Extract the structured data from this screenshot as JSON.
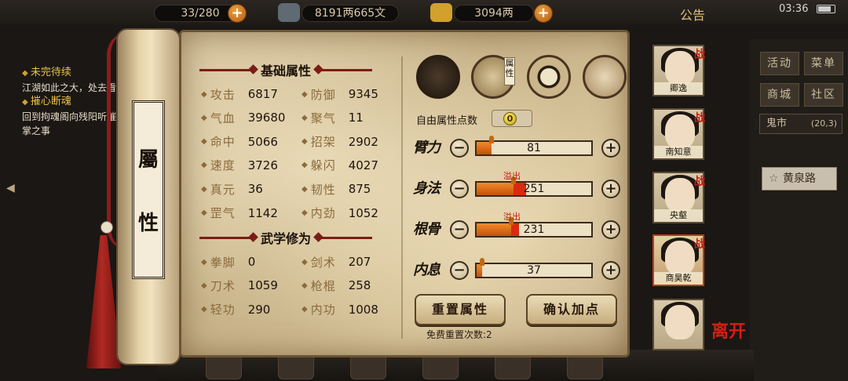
{
  "top_bar": {
    "stamina": "33/280",
    "money": "8191两665文",
    "gold": "3094两",
    "announcement": "公告",
    "time": "03:36"
  },
  "quests": [
    {
      "title": "未完待续",
      "desc": "江湖如此之大，处去看看"
    },
    {
      "title": "摧心断魂",
      "desc": "回到拘魂阁向残阳听摧心掌之事"
    }
  ],
  "right_menu": {
    "buttons": [
      "活动",
      "菜单",
      "商城",
      "社区"
    ],
    "location": "鬼市",
    "coords": "(20,3)",
    "road": "黄泉路"
  },
  "scroll": {
    "title_chars": [
      "屬",
      "性"
    ]
  },
  "basic": {
    "title": "基础属性",
    "stats": [
      {
        "label": "攻击",
        "value": "6817"
      },
      {
        "label": "防御",
        "value": "9345"
      },
      {
        "label": "气血",
        "value": "39680"
      },
      {
        "label": "聚气",
        "value": "11"
      },
      {
        "label": "命中",
        "value": "5066"
      },
      {
        "label": "招架",
        "value": "2902"
      },
      {
        "label": "速度",
        "value": "3726"
      },
      {
        "label": "躲闪",
        "value": "4027"
      },
      {
        "label": "真元",
        "value": "36"
      },
      {
        "label": "韧性",
        "value": "875"
      },
      {
        "label": "罡气",
        "value": "1142"
      },
      {
        "label": "内劲",
        "value": "1052"
      }
    ]
  },
  "martial": {
    "title": "武学修为",
    "stats": [
      {
        "label": "拳脚",
        "value": "0"
      },
      {
        "label": "剑术",
        "value": "207"
      },
      {
        "label": "刀术",
        "value": "1059"
      },
      {
        "label": "枪棍",
        "value": "258"
      },
      {
        "label": "轻功",
        "value": "290"
      },
      {
        "label": "内功",
        "value": "1008"
      }
    ]
  },
  "tabs": {
    "attr_label": "属性"
  },
  "points": {
    "label": "自由属性点数",
    "value": "0"
  },
  "attributes": [
    {
      "name": "臂力",
      "value": "81",
      "fill": 0.13,
      "overflow": 0,
      "overflow_label": ""
    },
    {
      "name": "身法",
      "value": "251",
      "fill": 0.32,
      "overflow": 0.11,
      "overflow_label": "溢出"
    },
    {
      "name": "根骨",
      "value": "231",
      "fill": 0.3,
      "overflow": 0.07,
      "overflow_label": "溢出"
    },
    {
      "name": "内息",
      "value": "37",
      "fill": 0.05,
      "overflow": 0,
      "overflow_label": ""
    }
  ],
  "controls": {
    "minus": "−",
    "plus": "+"
  },
  "actions": {
    "reset": "重置属性",
    "confirm": "确认加点",
    "free_reset": "免费重置次数:2"
  },
  "roster": [
    {
      "name": "卿逸",
      "badge": "战"
    },
    {
      "name": "南知意",
      "badge": "战"
    },
    {
      "name": "央壑",
      "badge": "战"
    },
    {
      "name": "商昊乾",
      "badge": "战"
    },
    {
      "name": "",
      "badge": ""
    }
  ],
  "leave": "离开",
  "colors": {
    "parchment": "#cbb68c",
    "accent_red": "#7a1d16",
    "bar_fill": "#f28a2a",
    "bar_overflow": "#d92a10"
  }
}
